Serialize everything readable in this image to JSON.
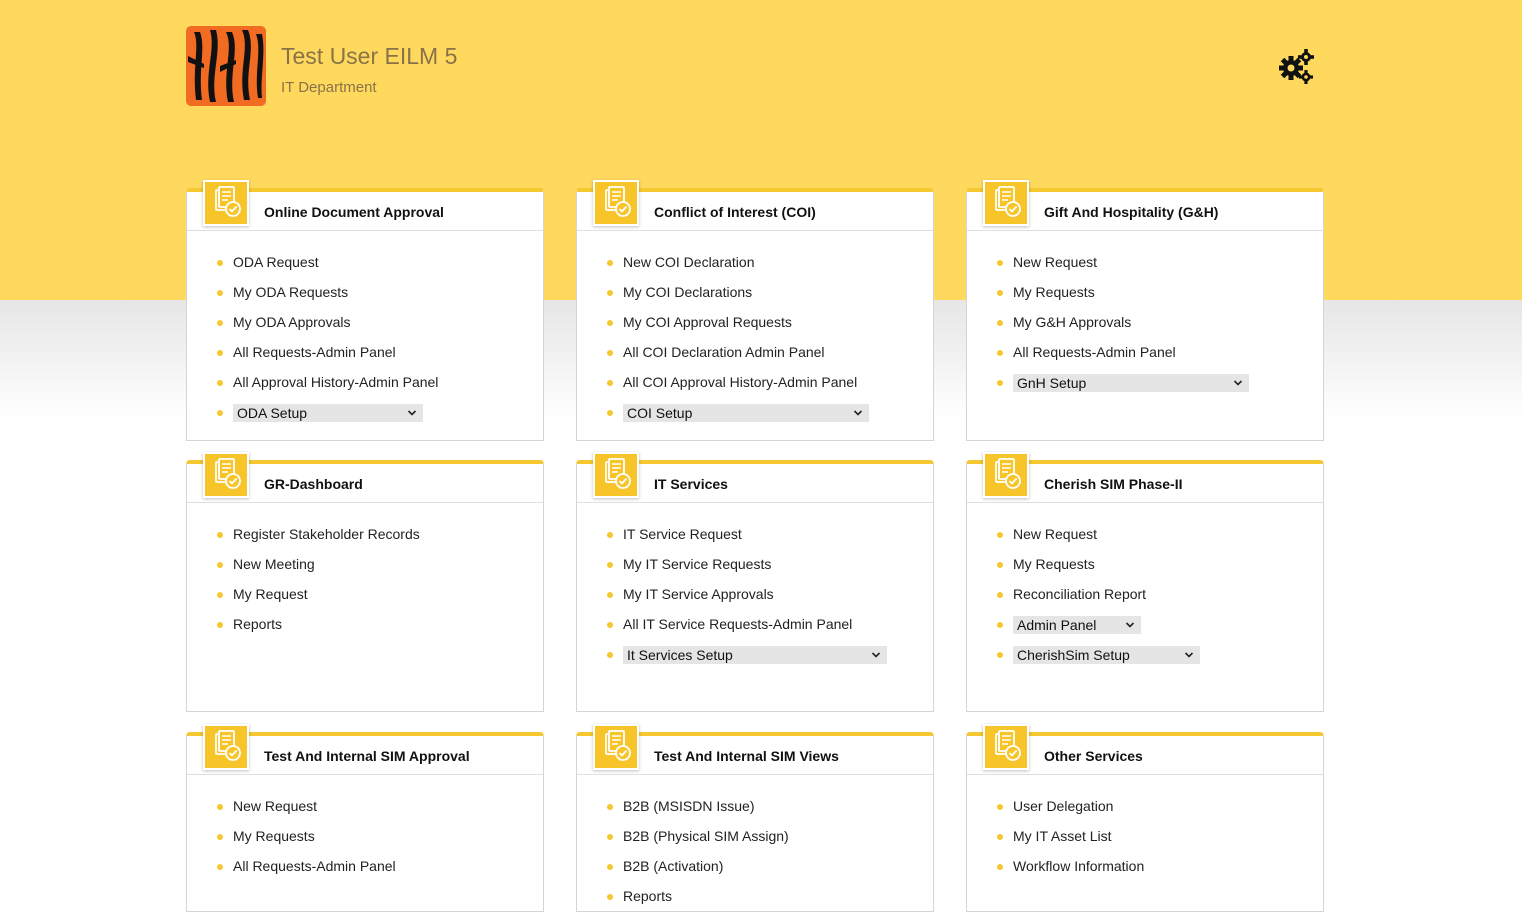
{
  "header": {
    "user_name": "Test User EILM 5",
    "department": "IT Department",
    "logo_icon": "tiger-stripes-logo",
    "settings_icon": "gears-icon"
  },
  "colors": {
    "accent": "#f5c82f",
    "header_bg": "#ffd95e",
    "logo_bg": "#f26b22"
  },
  "cards": [
    {
      "title": "Online Document Approval",
      "items": [
        "ODA Request",
        "My ODA Requests",
        "My ODA Approvals",
        "All Requests-Admin Panel",
        "All Approval History-Admin Panel"
      ],
      "selects": [
        "ODA Setup"
      ]
    },
    {
      "title": "Conflict of Interest (COI)",
      "items": [
        "New COI Declaration",
        "My COI Declarations",
        "My COI Approval Requests",
        "All COI Declaration Admin Panel",
        "All COI Approval History-Admin Panel"
      ],
      "selects": [
        "COI Setup"
      ]
    },
    {
      "title": "Gift And Hospitality (G&H)",
      "items": [
        "New Request",
        "My Requests",
        "My G&H Approvals",
        "All Requests-Admin Panel"
      ],
      "selects": [
        "GnH Setup"
      ]
    },
    {
      "title": "GR-Dashboard",
      "items": [
        "Register Stakeholder Records",
        "New Meeting",
        "My Request",
        "Reports"
      ],
      "selects": []
    },
    {
      "title": "IT Services",
      "items": [
        "IT Service Request",
        "My IT Service Requests",
        "My IT Service Approvals",
        "All IT Service Requests-Admin Panel"
      ],
      "selects": [
        "It Services Setup"
      ]
    },
    {
      "title": "Cherish SIM Phase-II",
      "items": [
        "New Request",
        "My Requests",
        "Reconciliation Report"
      ],
      "selects": [
        "Admin Panel",
        "CherishSim Setup"
      ]
    },
    {
      "title": "Test And Internal SIM Approval",
      "items": [
        "New Request",
        "My Requests",
        "All Requests-Admin Panel"
      ],
      "selects": []
    },
    {
      "title": "Test And Internal SIM Views",
      "items": [
        "B2B (MSISDN Issue)",
        "B2B (Physical SIM Assign)",
        "B2B (Activation)",
        "Reports"
      ],
      "selects": []
    },
    {
      "title": "Other Services",
      "items": [
        "User Delegation",
        "My IT Asset List",
        "Workflow Information"
      ],
      "selects": []
    }
  ]
}
